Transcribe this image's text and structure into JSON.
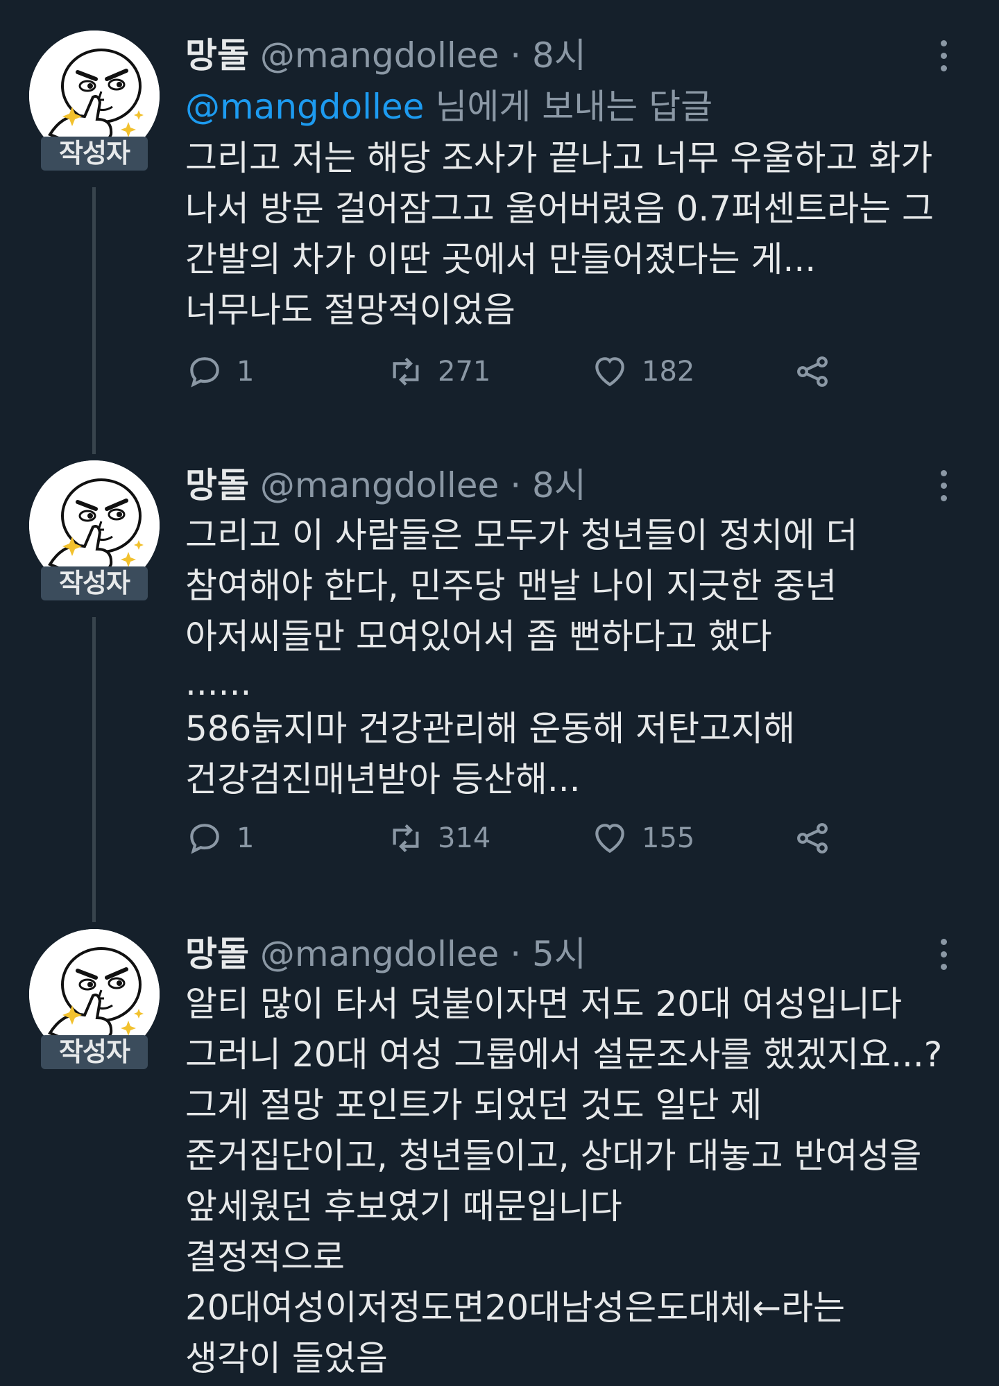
{
  "tweets": [
    {
      "name": "망돌",
      "handle": "@mangdollee",
      "dot": "·",
      "time": "8시",
      "badge": "작성자",
      "reply_prefix": "@mangdollee",
      "reply_suffix": " 님에게 보내는 답글",
      "lines": [
        "그리고 저는 해당 조사가 끝나고 너무 우울하고 화가",
        "나서 방문 걸어잠그고 울어버렸음 0.7퍼센트라는 그",
        "간발의 차가 이딴 곳에서 만들어졌다는 게...",
        "너무나도 절망적이었음"
      ],
      "replies": "1",
      "retweets": "271",
      "likes": "182"
    },
    {
      "name": "망돌",
      "handle": "@mangdollee",
      "dot": "·",
      "time": "8시",
      "badge": "작성자",
      "lines": [
        "그리고 이 사람들은 모두가 청년들이 정치에 더",
        "참여해야 한다, 민주당 맨날 나이 지긋한 중년",
        "아저씨들만 모여있어서 좀 뻔하다고 했다",
        "......",
        "586늙지마 건강관리해 운동해 저탄고지해",
        "건강검진매년받아 등산해..."
      ],
      "replies": "1",
      "retweets": "314",
      "likes": "155"
    },
    {
      "name": "망돌",
      "handle": "@mangdollee",
      "dot": "·",
      "time": "5시",
      "badge": "작성자",
      "lines": [
        "알티 많이 타서 덧붙이자면 저도 20대 여성입니다",
        "그러니 20대 여성 그룹에서 설문조사를 했겠지요...?",
        "그게 절망 포인트가 되었던 것도 일단 제",
        "준거집단이고, 청년들이고, 상대가 대놓고 반여성을",
        "앞세웠던 후보였기 때문입니다",
        "결정적으로",
        "20대여성이저정도면20대남성은도대체←라는",
        "생각이 들었음"
      ]
    }
  ],
  "colors": {
    "background": "#15202b",
    "text": "#e7e9ea",
    "secondary": "#8b98a5",
    "link": "#1d9bf0",
    "badge": "#3b4c5c",
    "thread_line": "#38444d"
  },
  "icons": [
    "reply-icon",
    "retweet-icon",
    "like-icon",
    "share-icon",
    "more-icon"
  ]
}
